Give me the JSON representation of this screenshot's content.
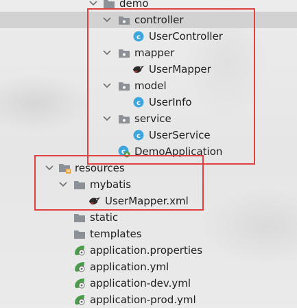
{
  "tree": {
    "items": [
      {
        "key": "demo",
        "label": "demo",
        "icon": "folder-icon",
        "chevron": "chevron-down-icon"
      },
      {
        "key": "controller",
        "label": "controller",
        "icon": "package-folder-icon",
        "chevron": "chevron-down-icon"
      },
      {
        "key": "usercontroller",
        "label": "UserController",
        "icon": "java-class-icon"
      },
      {
        "key": "mapper",
        "label": "mapper",
        "icon": "package-folder-icon",
        "chevron": "chevron-down-icon"
      },
      {
        "key": "usermapper",
        "label": "UserMapper",
        "icon": "mybatis-bird-icon"
      },
      {
        "key": "model",
        "label": "model",
        "icon": "package-folder-icon",
        "chevron": "chevron-down-icon"
      },
      {
        "key": "userinfo",
        "label": "UserInfo",
        "icon": "java-class-icon"
      },
      {
        "key": "service",
        "label": "service",
        "icon": "package-folder-icon",
        "chevron": "chevron-down-icon"
      },
      {
        "key": "userservice",
        "label": "UserService",
        "icon": "java-class-icon"
      },
      {
        "key": "demoapplication",
        "label": "DemoApplication",
        "icon": "spring-boot-app-icon"
      },
      {
        "key": "resources",
        "label": "resources",
        "icon": "resources-folder-icon",
        "chevron": "chevron-down-icon"
      },
      {
        "key": "mybatis",
        "label": "mybatis",
        "icon": "folder-icon",
        "chevron": "chevron-down-icon"
      },
      {
        "key": "usermapperxml",
        "label": "UserMapper.xml",
        "icon": "mybatis-bird-icon"
      },
      {
        "key": "static",
        "label": "static",
        "icon": "folder-icon"
      },
      {
        "key": "templates",
        "label": "templates",
        "icon": "folder-icon"
      },
      {
        "key": "appprops",
        "label": "application.properties",
        "icon": "spring-config-icon"
      },
      {
        "key": "appyml",
        "label": "application.yml",
        "icon": "spring-config-icon"
      },
      {
        "key": "appdevyml",
        "label": "application-dev.yml",
        "icon": "spring-config-icon"
      },
      {
        "key": "appprodyml",
        "label": "application-prod.yml",
        "icon": "spring-config-icon"
      }
    ]
  },
  "colors": {
    "highlight_box": "#e0413e",
    "selection": "#d2d2d2",
    "folder": "#8c9097",
    "java_class": "#3ea6dc",
    "spring": "#4b9d4c"
  }
}
